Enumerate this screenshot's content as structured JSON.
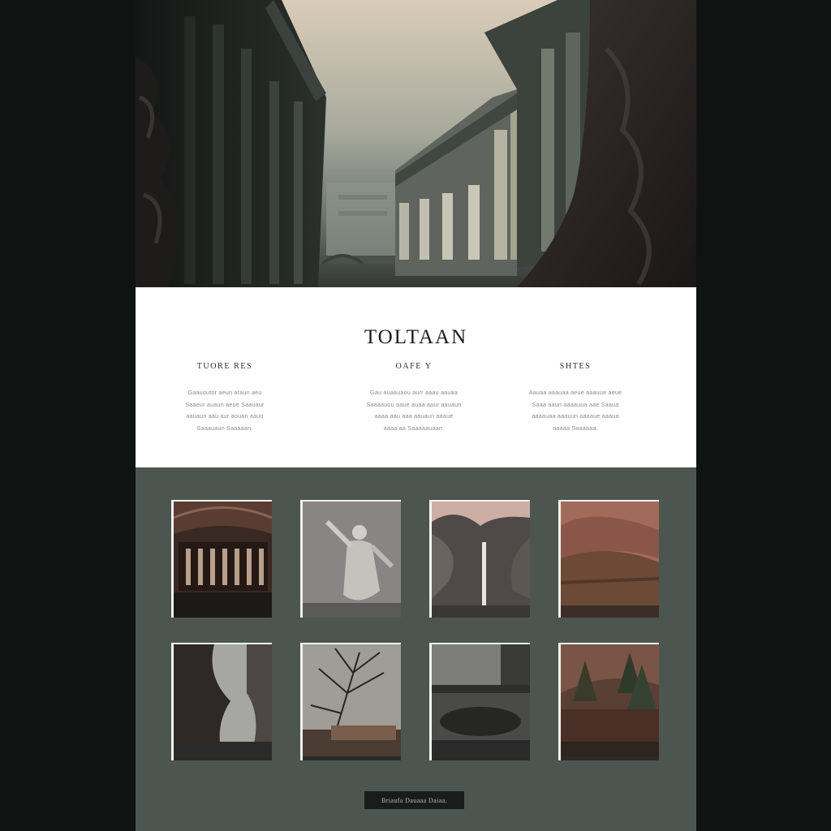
{
  "site": {
    "title": "TOLTAAN"
  },
  "columns": [
    {
      "heading": "TUORE RES",
      "text": [
        "Gaauoutor aeun araun aeu",
        "Saaeur auaun aeue Saauaur",
        "aauaun aau aur aouan aauo",
        "Saaauaun Saaaaan."
      ]
    },
    {
      "heading": "OAFE Y",
      "text": [
        "Gau auaauaou aurr aaau aauaa",
        "Saaaauou aaue auaa aaur aauaun",
        "aaaa aau aaa aauaun aaaue",
        "aaaa aa Saaaaauaan."
      ]
    },
    {
      "heading": "SHTES",
      "text": [
        "Aauaa aaauaa aeue aaauue aeue",
        "Saaa aaun aaaauua aae Saaua",
        "aaaauaa aaauun aaaaue aaaua",
        "aaaaa Saaaaaa."
      ]
    }
  ],
  "gallery": {
    "items": [
      {
        "name": "thumb-ceiling",
        "scene": "ceiling"
      },
      {
        "name": "thumb-statue",
        "scene": "statue"
      },
      {
        "name": "thumb-waterfall",
        "scene": "waterfall"
      },
      {
        "name": "thumb-red-valley",
        "scene": "valley"
      },
      {
        "name": "thumb-misty-cliff",
        "scene": "mist"
      },
      {
        "name": "thumb-bare-tree",
        "scene": "tree"
      },
      {
        "name": "thumb-bridge",
        "scene": "bridge"
      },
      {
        "name": "thumb-forest",
        "scene": "forest"
      }
    ]
  },
  "footer": {
    "button_label": "Briaufa Dauaaa Daiaa."
  },
  "colors": {
    "outer_background": "#0f1312",
    "page_background": "#4c5550",
    "info_background": "#ffffff",
    "button_background": "#1a1c1b"
  }
}
